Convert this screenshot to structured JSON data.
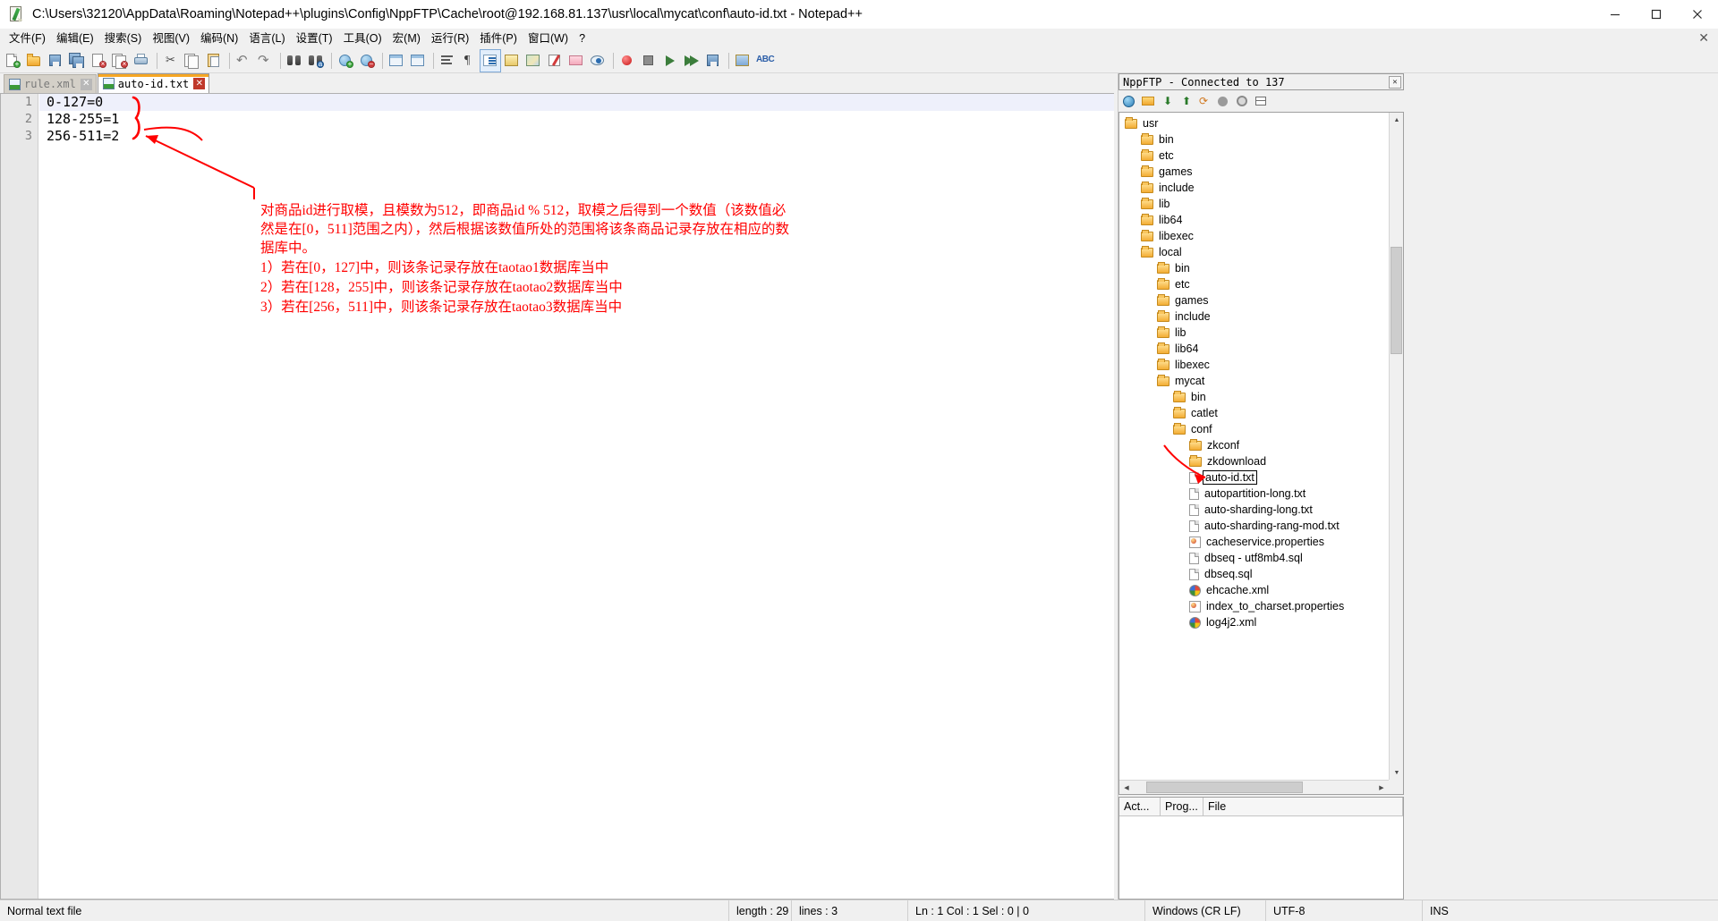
{
  "window": {
    "title": "C:\\Users\\32120\\AppData\\Roaming\\Notepad++\\plugins\\Config\\NppFTP\\Cache\\root@192.168.81.137\\usr\\local\\mycat\\conf\\auto-id.txt - Notepad++",
    "icon": "notepad-plus-plus-icon",
    "minimize_label": "─",
    "maximize_label": "❐",
    "close_label": "✕"
  },
  "menubar": {
    "items": [
      {
        "label": "文件(F)",
        "name": "menu-file"
      },
      {
        "label": "编辑(E)",
        "name": "menu-edit"
      },
      {
        "label": "搜索(S)",
        "name": "menu-search"
      },
      {
        "label": "视图(V)",
        "name": "menu-view"
      },
      {
        "label": "编码(N)",
        "name": "menu-encoding"
      },
      {
        "label": "语言(L)",
        "name": "menu-language"
      },
      {
        "label": "设置(T)",
        "name": "menu-settings"
      },
      {
        "label": "工具(O)",
        "name": "menu-tools"
      },
      {
        "label": "宏(M)",
        "name": "menu-macro"
      },
      {
        "label": "运行(R)",
        "name": "menu-run"
      },
      {
        "label": "插件(P)",
        "name": "menu-plugins"
      },
      {
        "label": "窗口(W)",
        "name": "menu-window"
      },
      {
        "label": "?",
        "name": "menu-help"
      }
    ],
    "close_doc_label": "✕"
  },
  "toolbar": {
    "buttons": [
      {
        "name": "new-file-icon",
        "kind": "new"
      },
      {
        "name": "open-file-icon",
        "kind": "open"
      },
      {
        "name": "save-icon",
        "kind": "save"
      },
      {
        "name": "save-all-icon",
        "kind": "saveall"
      },
      {
        "name": "close-file-icon",
        "kind": "close"
      },
      {
        "name": "close-all-icon",
        "kind": "closeall"
      },
      {
        "name": "print-icon",
        "kind": "print"
      },
      {
        "name": "sep",
        "kind": "sep"
      },
      {
        "name": "cut-icon",
        "kind": "cut"
      },
      {
        "name": "copy-icon",
        "kind": "copy"
      },
      {
        "name": "paste-icon",
        "kind": "paste"
      },
      {
        "name": "sep",
        "kind": "sep"
      },
      {
        "name": "undo-icon",
        "kind": "undo"
      },
      {
        "name": "redo-icon",
        "kind": "redo"
      },
      {
        "name": "sep",
        "kind": "sep"
      },
      {
        "name": "find-icon",
        "kind": "find"
      },
      {
        "name": "replace-icon",
        "kind": "replace"
      },
      {
        "name": "sep",
        "kind": "sep"
      },
      {
        "name": "zoom-in-icon",
        "kind": "zoomin"
      },
      {
        "name": "zoom-out-icon",
        "kind": "zoomout"
      },
      {
        "name": "sep",
        "kind": "sep"
      },
      {
        "name": "sync-vertical-icon",
        "kind": "syncv"
      },
      {
        "name": "sync-horizontal-icon",
        "kind": "synch"
      },
      {
        "name": "sep",
        "kind": "sep"
      },
      {
        "name": "word-wrap-icon",
        "kind": "wrap"
      },
      {
        "name": "show-all-chars-icon",
        "kind": "pilcrow"
      },
      {
        "name": "indent-guide-icon",
        "kind": "indent"
      },
      {
        "name": "user-defined-language-icon",
        "kind": "udl"
      },
      {
        "name": "document-map-icon",
        "kind": "map"
      },
      {
        "name": "function-list-icon",
        "kind": "funclist"
      },
      {
        "name": "folder-workspace-icon",
        "kind": "workspace"
      },
      {
        "name": "monitoring-icon",
        "kind": "eye"
      },
      {
        "name": "sep",
        "kind": "sep"
      },
      {
        "name": "record-macro-icon",
        "kind": "record"
      },
      {
        "name": "stop-macro-icon",
        "kind": "stop"
      },
      {
        "name": "playback-macro-icon",
        "kind": "play"
      },
      {
        "name": "run-multiple-macro-icon",
        "kind": "runmulti"
      },
      {
        "name": "save-macro-icon",
        "kind": "savemacro"
      },
      {
        "name": "sep",
        "kind": "sep"
      },
      {
        "name": "run-icon",
        "kind": "runbtn"
      },
      {
        "name": "spellcheck-icon",
        "kind": "abc"
      }
    ]
  },
  "tabs": [
    {
      "label": "rule.xml",
      "active": false,
      "name": "tab-rule-xml"
    },
    {
      "label": "auto-id.txt",
      "active": true,
      "name": "tab-auto-id-txt"
    }
  ],
  "editor": {
    "line_numbers": [
      "1",
      "2",
      "3"
    ],
    "lines": [
      "0-127=0",
      "128-255=1",
      "256-511=2"
    ],
    "current_line_index": 0,
    "annotation_color": "#ff0000",
    "annotation_lines": [
      "对商品id进行取模，且模数为512，即商品id % 512，取模之后得到一个数值（该数值必",
      "然是在[0，511]范围之内），然后根据该数值所处的范围将该条商品记录存放在相应的数",
      "据库中。",
      "1）若在[0，127]中，则该条记录存放在taotao1数据库当中",
      "2）若在[128，255]中，则该条记录存放在taotao2数据库当中",
      "3）若在[256，511]中，则该条记录存放在taotao3数据库当中"
    ]
  },
  "ftp_panel": {
    "caption": "NppFTP - Connected to 137",
    "close_label": "✕",
    "toolbar_buttons": [
      {
        "name": "connect-icon",
        "kind": "globe"
      },
      {
        "name": "open-dir-icon",
        "kind": "folder"
      },
      {
        "name": "download-icon",
        "kind": "down"
      },
      {
        "name": "upload-icon",
        "kind": "up"
      },
      {
        "name": "refresh-icon",
        "kind": "refresh"
      },
      {
        "name": "abort-icon",
        "kind": "stop"
      },
      {
        "name": "settings-icon",
        "kind": "gear"
      },
      {
        "name": "messages-icon",
        "kind": "grid"
      }
    ],
    "tree": [
      {
        "label": "usr",
        "type": "folder",
        "depth": 0
      },
      {
        "label": "bin",
        "type": "folder",
        "depth": 1
      },
      {
        "label": "etc",
        "type": "folder",
        "depth": 1
      },
      {
        "label": "games",
        "type": "folder",
        "depth": 1
      },
      {
        "label": "include",
        "type": "folder",
        "depth": 1
      },
      {
        "label": "lib",
        "type": "folder",
        "depth": 1
      },
      {
        "label": "lib64",
        "type": "folder",
        "depth": 1
      },
      {
        "label": "libexec",
        "type": "folder",
        "depth": 1
      },
      {
        "label": "local",
        "type": "folder",
        "depth": 1
      },
      {
        "label": "bin",
        "type": "folder",
        "depth": 2
      },
      {
        "label": "etc",
        "type": "folder",
        "depth": 2
      },
      {
        "label": "games",
        "type": "folder",
        "depth": 2
      },
      {
        "label": "include",
        "type": "folder",
        "depth": 2
      },
      {
        "label": "lib",
        "type": "folder",
        "depth": 2
      },
      {
        "label": "lib64",
        "type": "folder",
        "depth": 2
      },
      {
        "label": "libexec",
        "type": "folder",
        "depth": 2
      },
      {
        "label": "mycat",
        "type": "folder",
        "depth": 2
      },
      {
        "label": "bin",
        "type": "folder",
        "depth": 3
      },
      {
        "label": "catlet",
        "type": "folder",
        "depth": 3
      },
      {
        "label": "conf",
        "type": "folder",
        "depth": 3
      },
      {
        "label": "zkconf",
        "type": "folder",
        "depth": 4
      },
      {
        "label": "zkdownload",
        "type": "folder",
        "depth": 4
      },
      {
        "label": "auto-id.txt",
        "type": "file",
        "depth": 4,
        "selected": true
      },
      {
        "label": "autopartition-long.txt",
        "type": "file",
        "depth": 4
      },
      {
        "label": "auto-sharding-long.txt",
        "type": "file",
        "depth": 4
      },
      {
        "label": "auto-sharding-rang-mod.txt",
        "type": "file",
        "depth": 4
      },
      {
        "label": "cacheservice.properties",
        "type": "properties",
        "depth": 4
      },
      {
        "label": "dbseq - utf8mb4.sql",
        "type": "file",
        "depth": 4
      },
      {
        "label": "dbseq.sql",
        "type": "file",
        "depth": 4
      },
      {
        "label": "ehcache.xml",
        "type": "xml",
        "depth": 4
      },
      {
        "label": "index_to_charset.properties",
        "type": "properties",
        "depth": 4
      },
      {
        "label": "log4j2.xml",
        "type": "xml",
        "depth": 4
      }
    ],
    "bottom_columns": [
      "Act...",
      "Prog...",
      "File"
    ]
  },
  "statusbar": {
    "file_type": "Normal text file",
    "length_label": "length : 29",
    "lines_label": "lines : 3",
    "position": "Ln : 1    Col : 1    Sel : 0 | 0",
    "eol": "Windows (CR LF)",
    "encoding": "UTF-8",
    "insert_mode": "INS"
  }
}
